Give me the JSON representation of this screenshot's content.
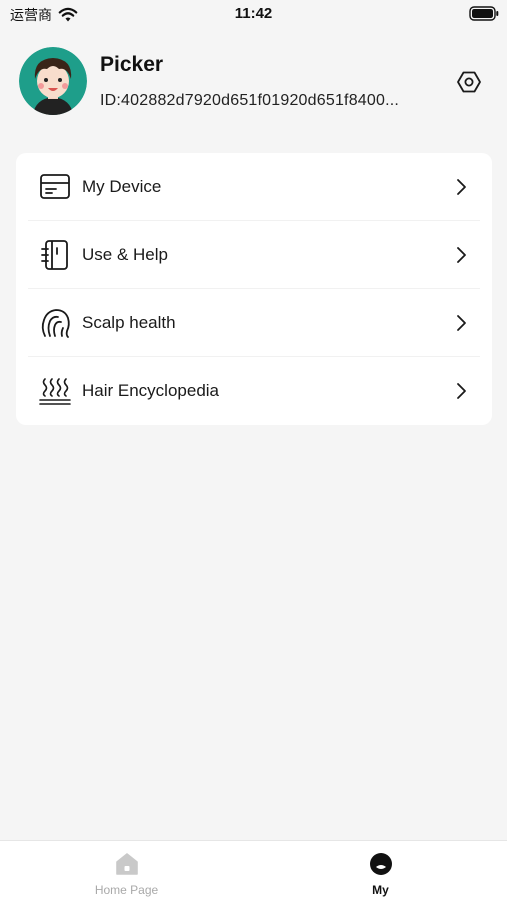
{
  "status_bar": {
    "carrier": "运营商",
    "time": "11:42"
  },
  "profile": {
    "name": "Picker",
    "id_text": "ID:402882d7920d651f01920d651f8400..."
  },
  "menu": {
    "items": [
      {
        "label": "My Device",
        "icon": "device-icon"
      },
      {
        "label": "Use & Help",
        "icon": "manual-icon"
      },
      {
        "label": "Scalp health",
        "icon": "scalp-icon"
      },
      {
        "label": "Hair Encyclopedia",
        "icon": "steam-waves-icon"
      }
    ]
  },
  "tab_bar": {
    "tabs": [
      {
        "label": "Home Page",
        "icon": "home-icon",
        "active": false
      },
      {
        "label": "My",
        "icon": "profile-icon",
        "active": true
      }
    ]
  },
  "colors": {
    "background": "#f5f5f5",
    "card": "#ffffff",
    "avatar_bg": "#1e9e8a",
    "inactive_tab": "#a9a9a9",
    "active_tab": "#111111"
  }
}
